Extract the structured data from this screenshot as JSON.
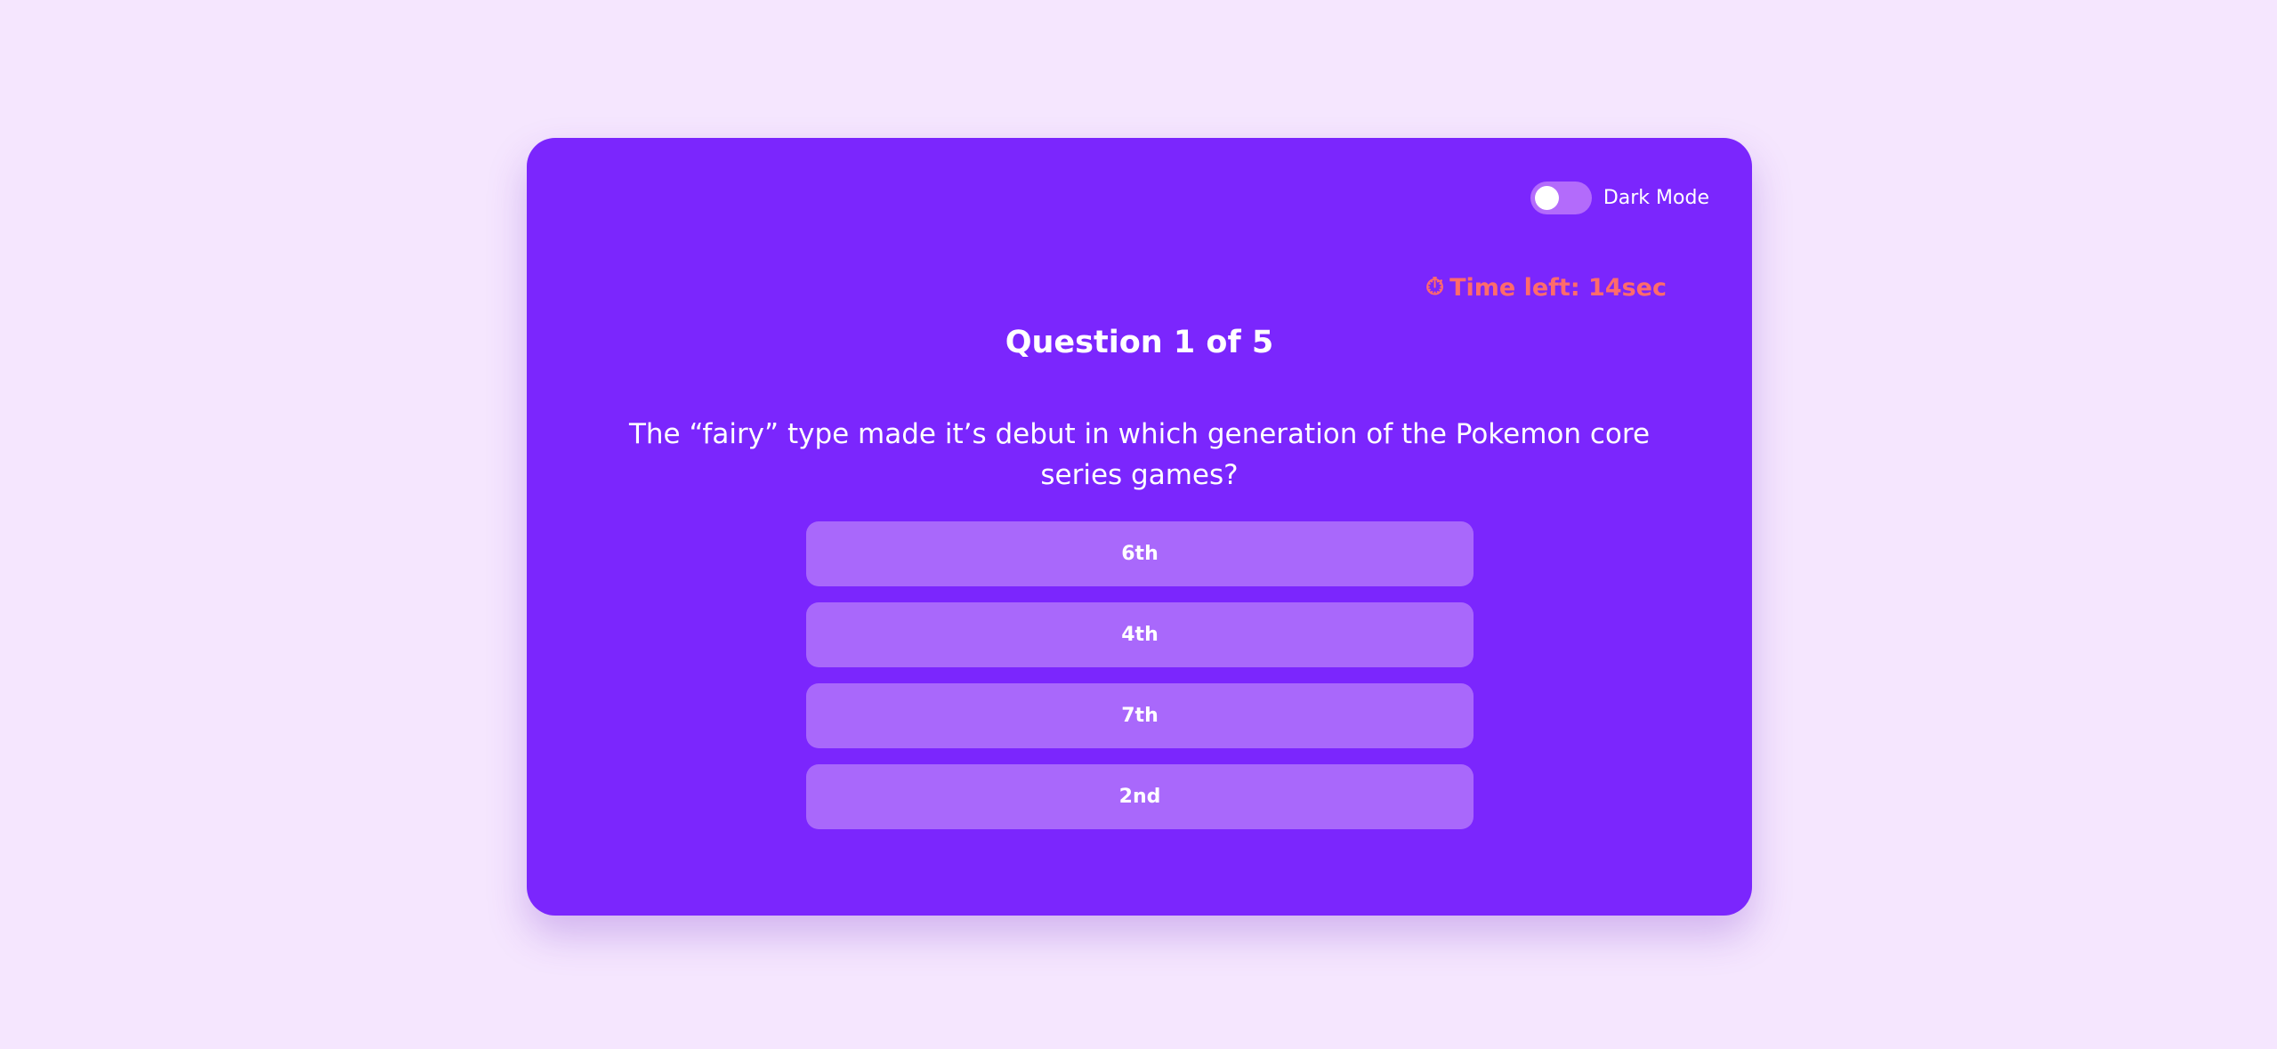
{
  "settings": {
    "dark_mode_label": "Dark Mode",
    "dark_mode_on": false
  },
  "timer": {
    "icon": "⏱",
    "text": "Time left: 14sec"
  },
  "quiz": {
    "counter": "Question 1 of 5",
    "question": "The “fairy” type made it’s debut in which generation of the Pokemon core series games?",
    "answers": [
      "6th",
      "4th",
      "7th",
      "2nd"
    ]
  },
  "colors": {
    "background": "#f5e6fe",
    "card": "#7b26fd",
    "answer_button": "#a968fb",
    "toggle_track": "#b36bfb",
    "timer_text": "#ff6b6b"
  }
}
